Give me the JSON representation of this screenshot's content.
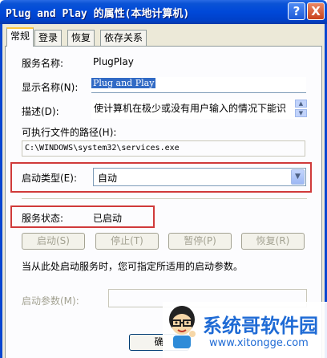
{
  "window": {
    "title": "Plug and Play 的属性(本地计算机)",
    "help_label": "?",
    "close_label": "X"
  },
  "tabs": [
    {
      "label": "常规"
    },
    {
      "label": "登录"
    },
    {
      "label": "恢复"
    },
    {
      "label": "依存关系"
    }
  ],
  "general": {
    "service_name_label": "服务名称:",
    "service_name_value": "PlugPlay",
    "display_name_label": "显示名称(N):",
    "display_name_value": "Plug and Play",
    "description_label": "描述(D):",
    "description_value": "使计算机在极少或没有用户输入的情况下能识",
    "exe_path_label": "可执行文件的路径(H):",
    "exe_path_value": "C:\\WINDOWS\\system32\\services.exe",
    "startup_type_label": "启动类型(E):",
    "startup_type_value": "自动",
    "service_status_label": "服务状态:",
    "service_status_value": "已启动",
    "buttons": {
      "start": "启动(S)",
      "stop": "停止(T)",
      "pause": "暂停(P)",
      "resume": "恢复(R)"
    },
    "hint_text": "当从此处启动服务时，您可指定所适用的启动参数。",
    "start_params_label": "启动参数(M):",
    "start_params_value": ""
  },
  "footer": {
    "ok_label": "确"
  },
  "watermark": {
    "title": "系统哥软件园",
    "url": "www.xitongge.com"
  },
  "colors": {
    "titlebar": "#0048d8",
    "highlight_box": "#d03a3a",
    "selection": "#316ac5"
  }
}
